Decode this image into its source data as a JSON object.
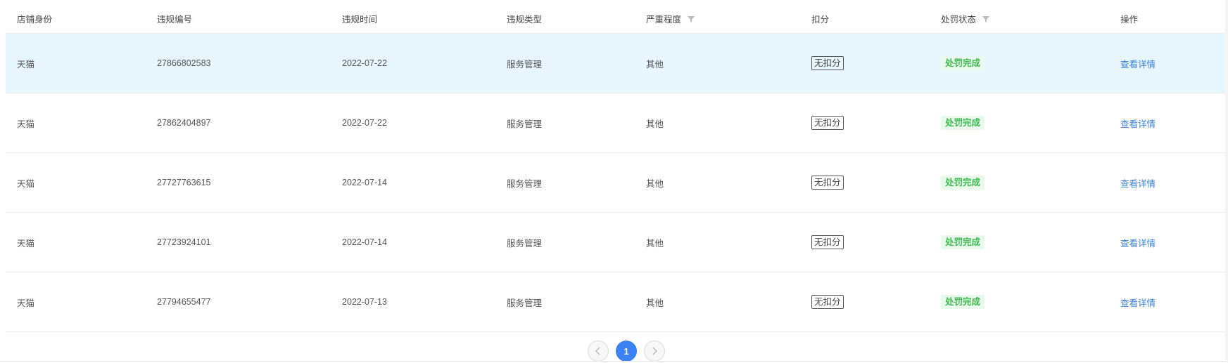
{
  "columns": [
    {
      "label": "店铺身份",
      "filter": false
    },
    {
      "label": "违规编号",
      "filter": false
    },
    {
      "label": "违规时间",
      "filter": false
    },
    {
      "label": "违规类型",
      "filter": false
    },
    {
      "label": "严重程度",
      "filter": true
    },
    {
      "label": "扣分",
      "filter": false
    },
    {
      "label": "处罚状态",
      "filter": true
    },
    {
      "label": "操作",
      "filter": false
    }
  ],
  "rows": [
    {
      "shop": "天猫",
      "id": "27866802583",
      "date": "2022-07-22",
      "type": "服务管理",
      "severity": "其他",
      "points": "无扣分",
      "status": "处罚完成",
      "action": "查看详情",
      "highlighted": true
    },
    {
      "shop": "天猫",
      "id": "27862404897",
      "date": "2022-07-22",
      "type": "服务管理",
      "severity": "其他",
      "points": "无扣分",
      "status": "处罚完成",
      "action": "查看详情",
      "highlighted": false
    },
    {
      "shop": "天猫",
      "id": "27727763615",
      "date": "2022-07-14",
      "type": "服务管理",
      "severity": "其他",
      "points": "无扣分",
      "status": "处罚完成",
      "action": "查看详情",
      "highlighted": false
    },
    {
      "shop": "天猫",
      "id": "27723924101",
      "date": "2022-07-14",
      "type": "服务管理",
      "severity": "其他",
      "points": "无扣分",
      "status": "处罚完成",
      "action": "查看详情",
      "highlighted": false
    },
    {
      "shop": "天猫",
      "id": "27794655477",
      "date": "2022-07-13",
      "type": "服务管理",
      "severity": "其他",
      "points": "无扣分",
      "status": "处罚完成",
      "action": "查看详情",
      "highlighted": false
    }
  ],
  "pagination": {
    "prev_icon": "chevron-left-icon",
    "current_page": "1",
    "next_icon": "chevron-right-icon"
  },
  "colors": {
    "highlight_row": "#e7f6fd",
    "status_green": "#3fb950",
    "link_blue": "#3a7fd5",
    "page_active": "#3b82f6"
  }
}
